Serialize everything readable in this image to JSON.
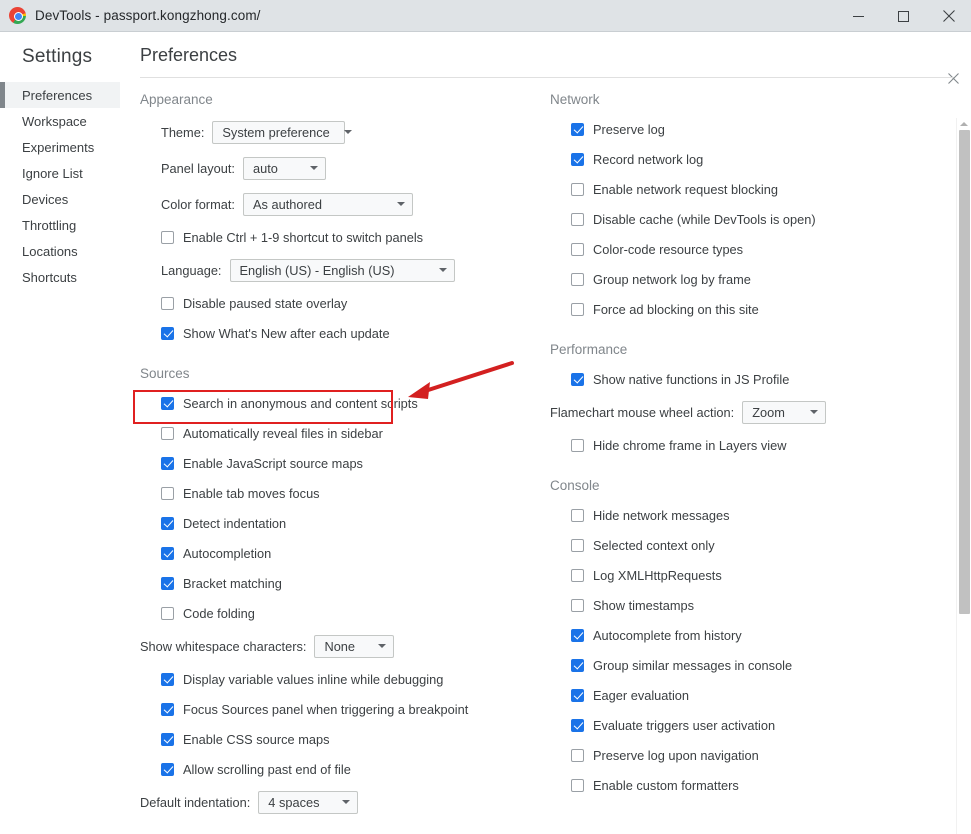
{
  "window": {
    "title": "DevTools - passport.kongzhong.com/",
    "logo_icon": "chrome-logo-icon",
    "minimize_icon": "minimize-icon",
    "maximize_icon": "maximize-icon",
    "close_icon": "close-icon"
  },
  "panel": {
    "close_icon": "panel-close-icon"
  },
  "sidebar": {
    "title": "Settings",
    "items": [
      {
        "label": "Preferences",
        "selected": true
      },
      {
        "label": "Workspace",
        "selected": false
      },
      {
        "label": "Experiments",
        "selected": false
      },
      {
        "label": "Ignore List",
        "selected": false
      },
      {
        "label": "Devices",
        "selected": false
      },
      {
        "label": "Throttling",
        "selected": false
      },
      {
        "label": "Locations",
        "selected": false
      },
      {
        "label": "Shortcuts",
        "selected": false
      }
    ]
  },
  "content": {
    "heading": "Preferences"
  },
  "appearance": {
    "title": "Appearance",
    "theme_label": "Theme:",
    "theme_value": "System preference",
    "panel_layout_label": "Panel layout:",
    "panel_layout_value": "auto",
    "color_format_label": "Color format:",
    "color_format_value": "As authored",
    "ctrl_shortcut_label": "Enable Ctrl + 1-9 shortcut to switch panels",
    "ctrl_shortcut_checked": false,
    "language_label": "Language:",
    "language_value": "English (US) - English (US)",
    "disable_paused_label": "Disable paused state overlay",
    "disable_paused_checked": false,
    "whats_new_label": "Show What's New after each update",
    "whats_new_checked": true
  },
  "sources": {
    "title": "Sources",
    "items": [
      {
        "label": "Search in anonymous and content scripts",
        "checked": true,
        "highlighted": true
      },
      {
        "label": "Automatically reveal files in sidebar",
        "checked": false
      },
      {
        "label": "Enable JavaScript source maps",
        "checked": true
      },
      {
        "label": "Enable tab moves focus",
        "checked": false
      },
      {
        "label": "Detect indentation",
        "checked": true
      },
      {
        "label": "Autocompletion",
        "checked": true
      },
      {
        "label": "Bracket matching",
        "checked": true
      },
      {
        "label": "Code folding",
        "checked": false
      }
    ],
    "whitespace_label": "Show whitespace characters:",
    "whitespace_value": "None",
    "items2": [
      {
        "label": "Display variable values inline while debugging",
        "checked": true
      },
      {
        "label": "Focus Sources panel when triggering a breakpoint",
        "checked": true
      },
      {
        "label": "Enable CSS source maps",
        "checked": true
      },
      {
        "label": "Allow scrolling past end of file",
        "checked": true
      }
    ],
    "indentation_label": "Default indentation:",
    "indentation_value": "4 spaces"
  },
  "network": {
    "title": "Network",
    "items": [
      {
        "label": "Preserve log",
        "checked": true
      },
      {
        "label": "Record network log",
        "checked": true
      },
      {
        "label": "Enable network request blocking",
        "checked": false
      },
      {
        "label": "Disable cache (while DevTools is open)",
        "checked": false
      },
      {
        "label": "Color-code resource types",
        "checked": false
      },
      {
        "label": "Group network log by frame",
        "checked": false
      },
      {
        "label": "Force ad blocking on this site",
        "checked": false
      }
    ]
  },
  "performance": {
    "title": "Performance",
    "native_functions_label": "Show native functions in JS Profile",
    "native_functions_checked": true,
    "flamechart_label": "Flamechart mouse wheel action:",
    "flamechart_value": "Zoom",
    "hide_chrome_frame_label": "Hide chrome frame in Layers view",
    "hide_chrome_frame_checked": false
  },
  "console": {
    "title": "Console",
    "items": [
      {
        "label": "Hide network messages",
        "checked": false
      },
      {
        "label": "Selected context only",
        "checked": false
      },
      {
        "label": "Log XMLHttpRequests",
        "checked": false
      },
      {
        "label": "Show timestamps",
        "checked": false
      },
      {
        "label": "Autocomplete from history",
        "checked": true
      },
      {
        "label": "Group similar messages in console",
        "checked": true
      },
      {
        "label": "Eager evaluation",
        "checked": true
      },
      {
        "label": "Evaluate triggers user activation",
        "checked": true
      },
      {
        "label": "Preserve log upon navigation",
        "checked": false
      },
      {
        "label": "Enable custom formatters",
        "checked": false
      }
    ]
  },
  "annotation": {
    "highlight_color": "#e02020",
    "arrow_color": "#d32020",
    "target": "Search in anonymous and content scripts"
  },
  "colors": {
    "accent": "#1a73e8",
    "titlebar": "#dfe3e6",
    "text": "#3c4043",
    "muted": "#80868b"
  }
}
